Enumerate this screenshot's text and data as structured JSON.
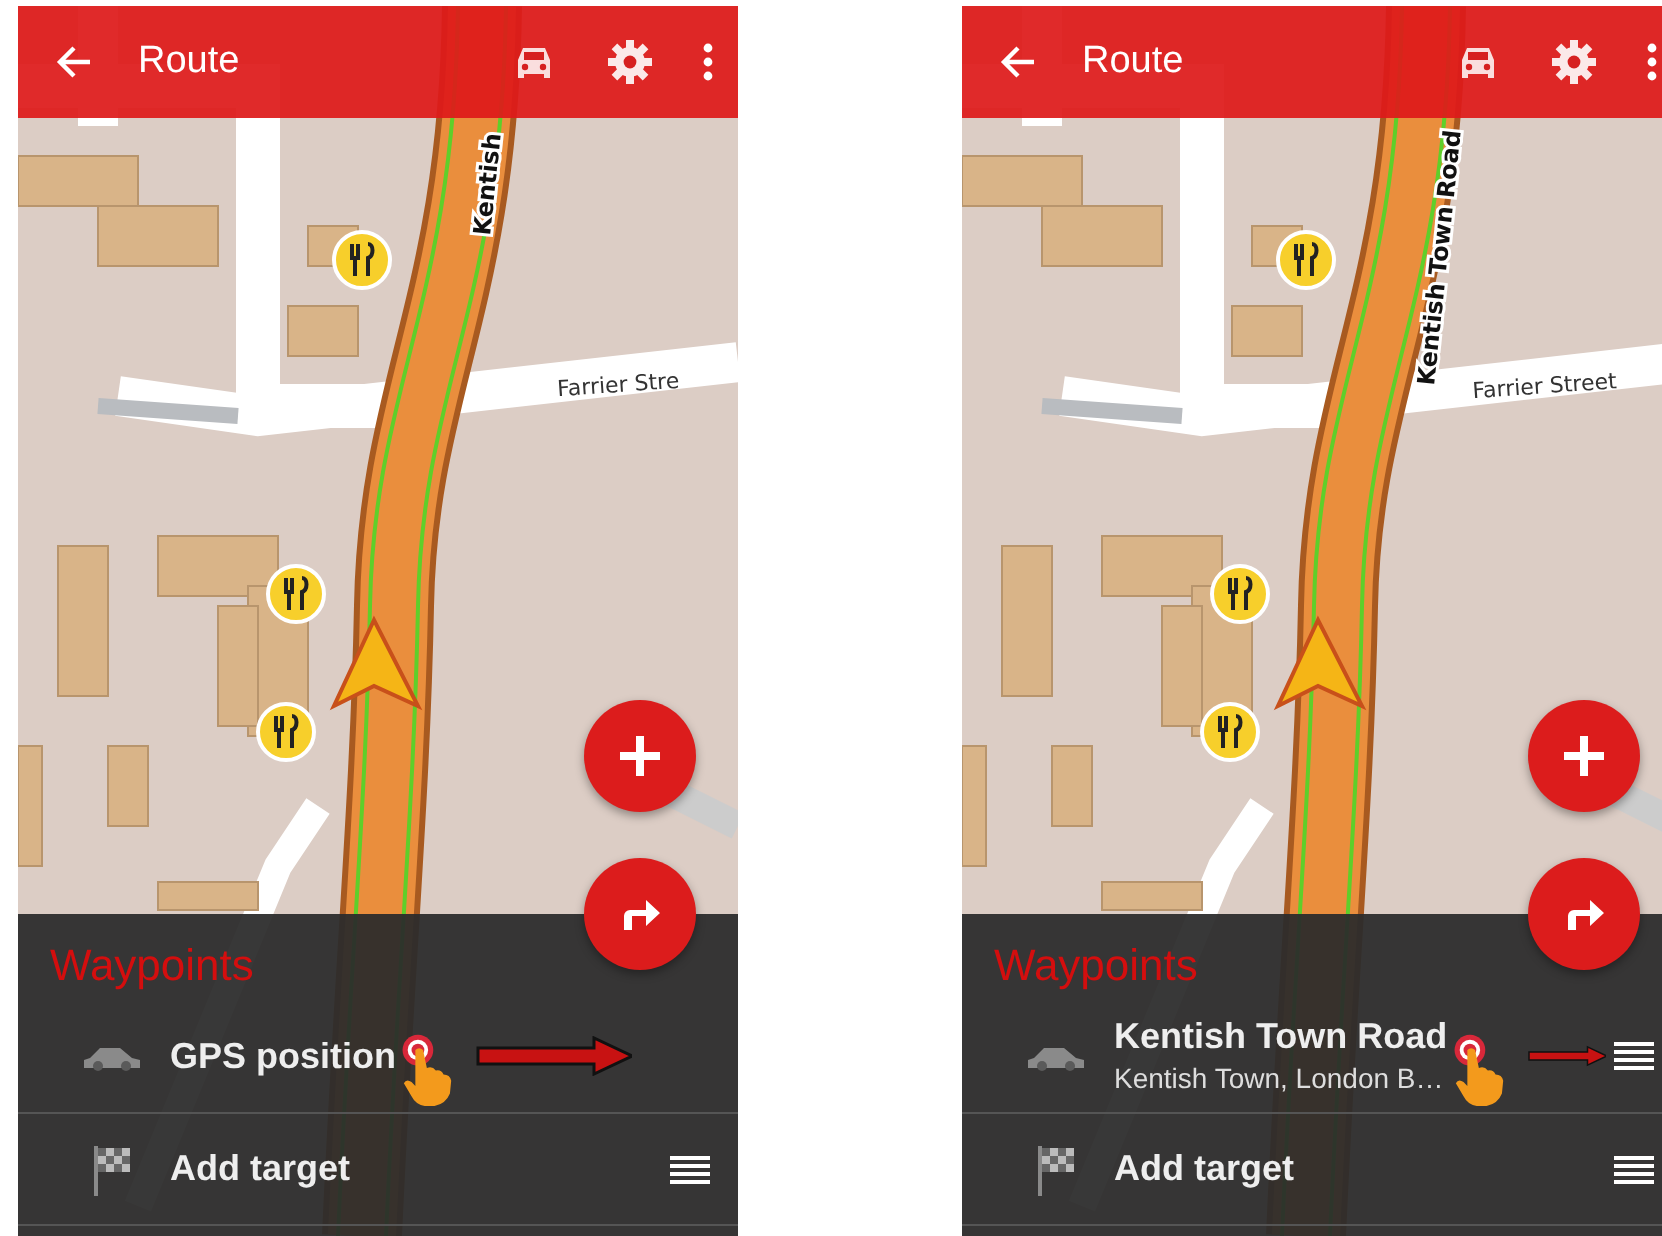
{
  "screens": [
    {
      "toolbar": {
        "title": "Route"
      },
      "map": {
        "labels": [
          {
            "kind": "vertical",
            "text": "Kentish"
          },
          {
            "kind": "street",
            "text": "Farrier Stre"
          }
        ]
      },
      "panel": {
        "heading": "Waypoints",
        "waypoints": [
          {
            "kind": "car",
            "title": "GPS position",
            "handle": false,
            "tapped": true
          },
          {
            "kind": "flag",
            "title": "Add target",
            "handle": true,
            "tapped": false
          }
        ]
      }
    },
    {
      "toolbar": {
        "title": "Route"
      },
      "map": {
        "labels": [
          {
            "kind": "vertical",
            "text": "Kentish Town Road"
          },
          {
            "kind": "street",
            "text": "Farrier Street"
          }
        ]
      },
      "panel": {
        "heading": "Waypoints",
        "waypoints": [
          {
            "kind": "car",
            "title": "Kentish Town Road",
            "subtitle": "Kentish Town, London B…",
            "handle": true,
            "tapped": true
          },
          {
            "kind": "flag",
            "title": "Add target",
            "handle": true,
            "tapped": false
          }
        ]
      }
    }
  ]
}
